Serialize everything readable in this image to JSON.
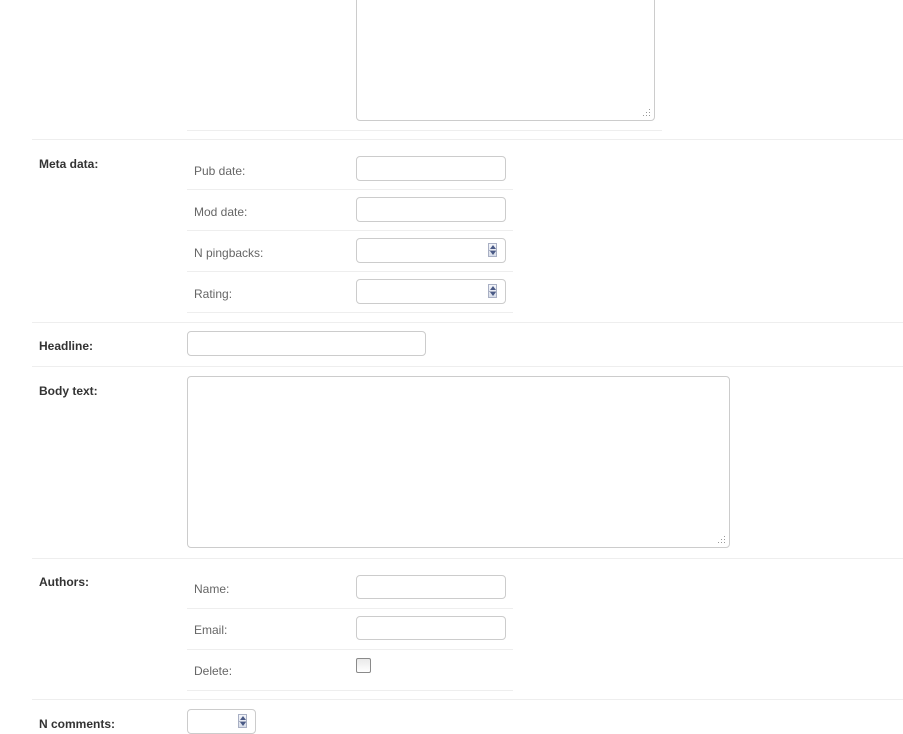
{
  "meta": {
    "label": "Meta data:",
    "fields": [
      {
        "label": "Pub date:",
        "value": ""
      },
      {
        "label": "Mod date:",
        "value": ""
      },
      {
        "label": "N pingbacks:",
        "value": ""
      },
      {
        "label": "Rating:",
        "value": ""
      }
    ]
  },
  "headline": {
    "label": "Headline:",
    "value": ""
  },
  "body_text": {
    "label": "Body text:",
    "value": ""
  },
  "authors": {
    "label": "Authors:",
    "fields": [
      {
        "label": "Name:",
        "value": ""
      },
      {
        "label": "Email:",
        "value": ""
      },
      {
        "label": "Delete:",
        "checked": false
      }
    ]
  },
  "n_comments": {
    "label": "N comments:",
    "value": ""
  }
}
